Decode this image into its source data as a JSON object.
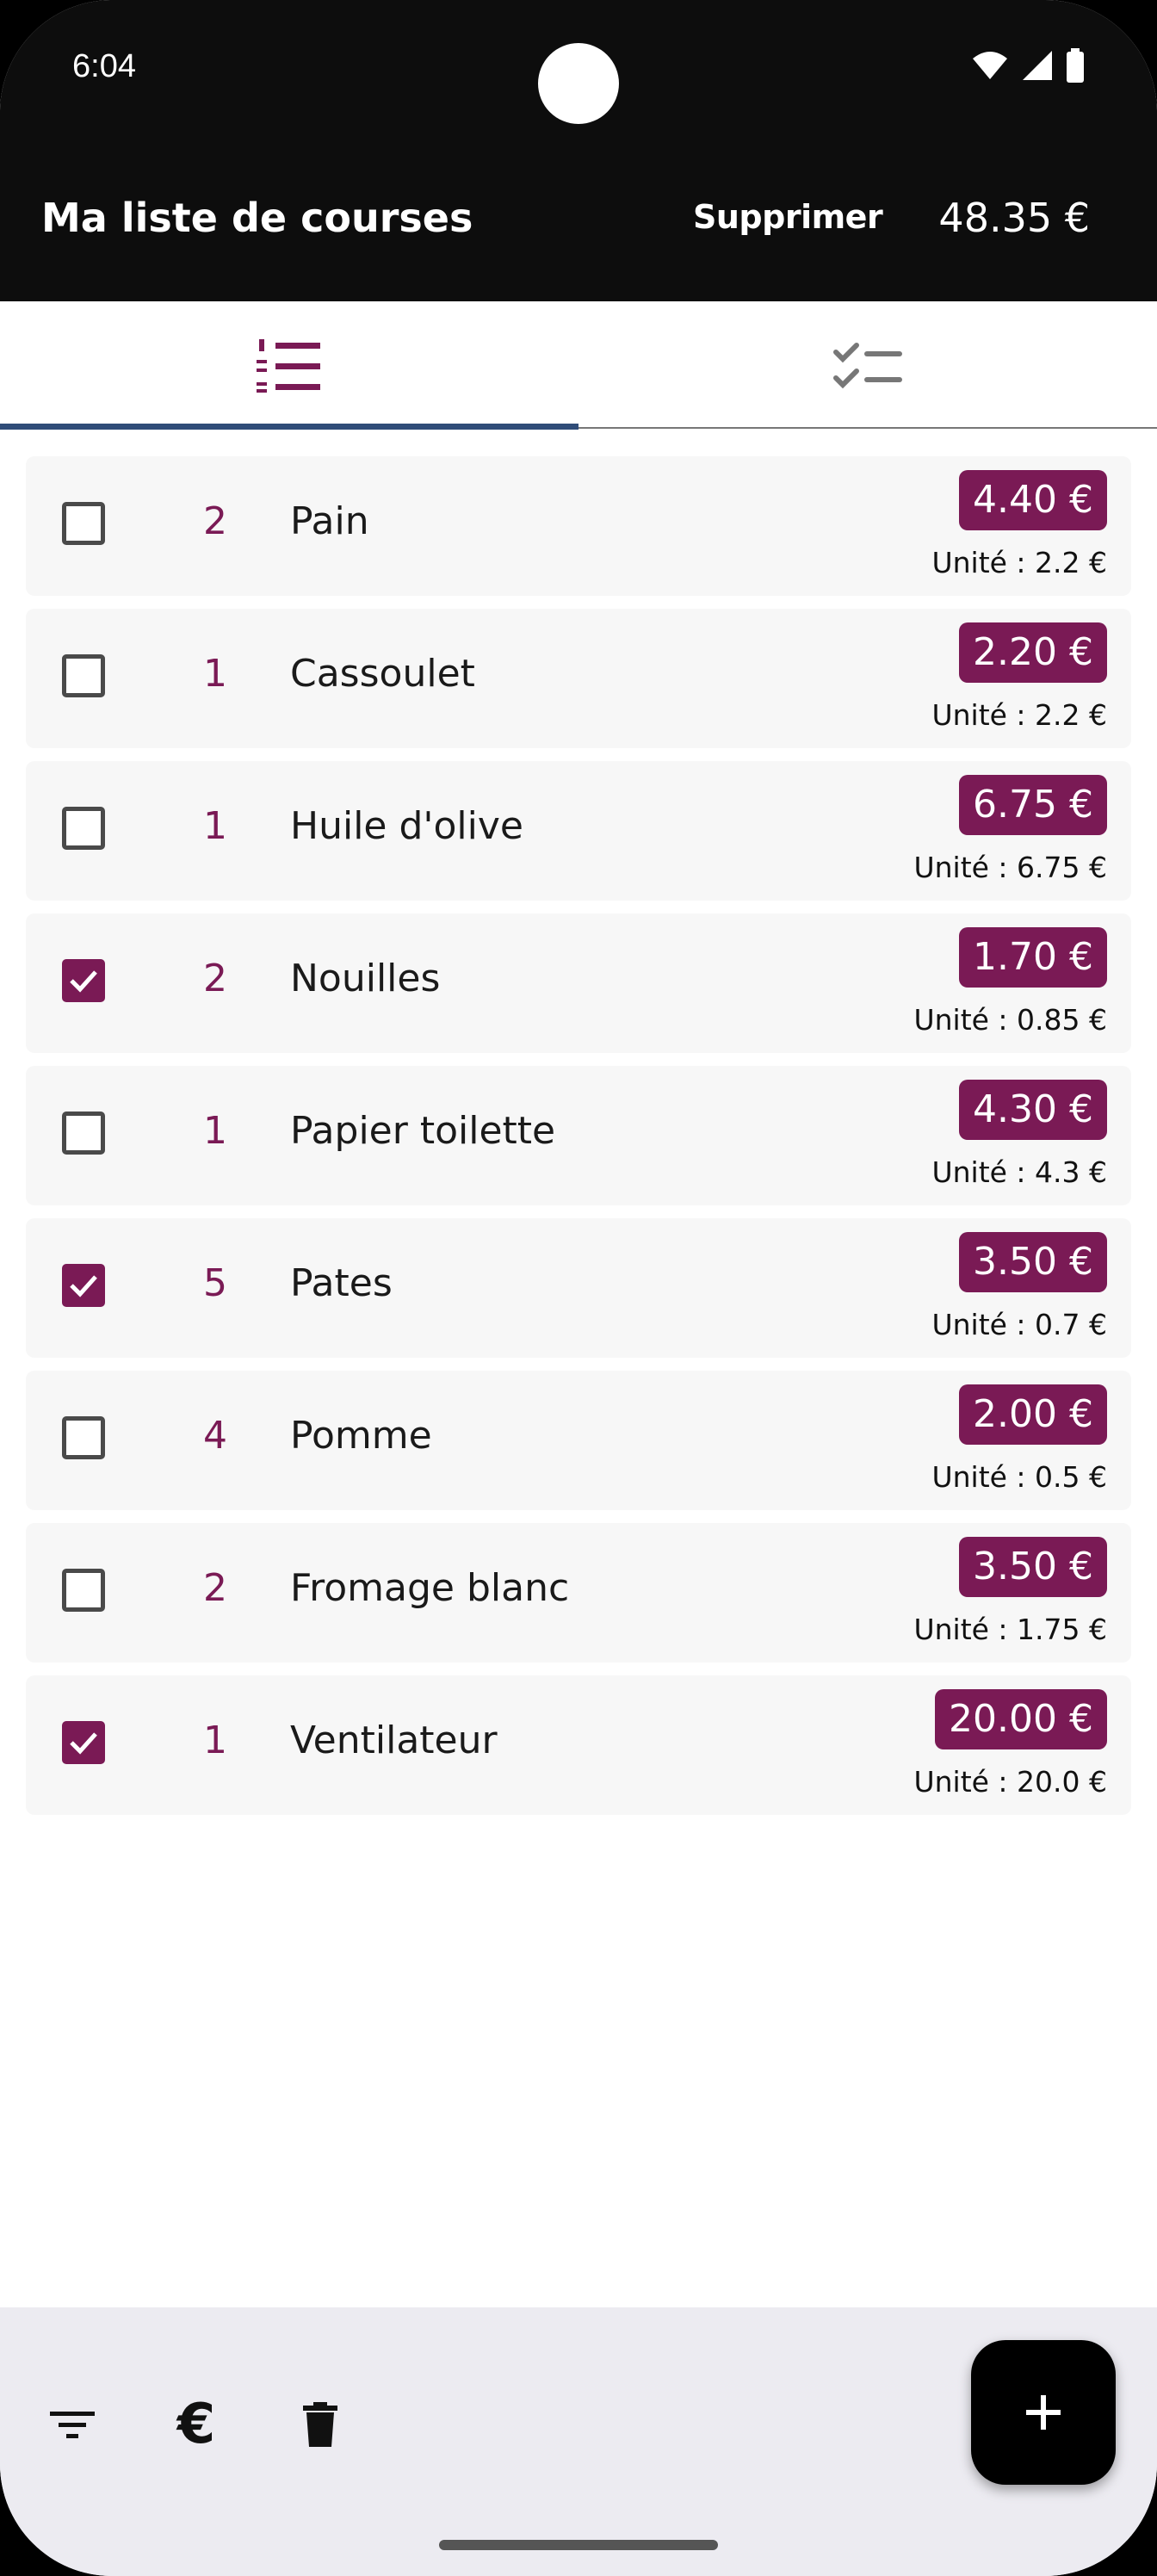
{
  "status_bar": {
    "time": "6:04"
  },
  "app_bar": {
    "title": "Ma liste de courses",
    "delete_label": "Supprimer",
    "total": "48.35 €"
  },
  "tabs": [
    {
      "icon": "numbered-list-icon",
      "selected": true
    },
    {
      "icon": "checklist-icon",
      "selected": false
    }
  ],
  "items": [
    {
      "checked": false,
      "qty": "2",
      "name": "Pain",
      "price": "4.40 €",
      "unit": "Unité : 2.2 €"
    },
    {
      "checked": false,
      "qty": "1",
      "name": "Cassoulet",
      "price": "2.20 €",
      "unit": "Unité : 2.2 €"
    },
    {
      "checked": false,
      "qty": "1",
      "name": "Huile d'olive",
      "price": "6.75 €",
      "unit": "Unité : 6.75 €"
    },
    {
      "checked": true,
      "qty": "2",
      "name": "Nouilles",
      "price": "1.70 €",
      "unit": "Unité : 0.85 €"
    },
    {
      "checked": false,
      "qty": "1",
      "name": "Papier toilette",
      "price": "4.30 €",
      "unit": "Unité : 4.3 €"
    },
    {
      "checked": true,
      "qty": "5",
      "name": "Pates",
      "price": "3.50 €",
      "unit": "Unité : 0.7 €"
    },
    {
      "checked": false,
      "qty": "4",
      "name": "Pomme",
      "price": "2.00 €",
      "unit": "Unité : 0.5 €"
    },
    {
      "checked": false,
      "qty": "2",
      "name": "Fromage blanc",
      "price": "3.50 €",
      "unit": "Unité : 1.75 €"
    },
    {
      "checked": true,
      "qty": "1",
      "name": "Ventilateur",
      "price": "20.00 €",
      "unit": "Unité : 20.0 €"
    }
  ],
  "bottom_bar": {
    "filter_icon": "filter-icon",
    "euro_label": "€",
    "trash_icon": "trash-icon",
    "fab_label": "+"
  },
  "colors": {
    "accent": "#7a1a55",
    "tab_indicator": "#2f4c78",
    "app_bar": "#0d0d0d",
    "bottom_bar": "#ecebf1"
  }
}
